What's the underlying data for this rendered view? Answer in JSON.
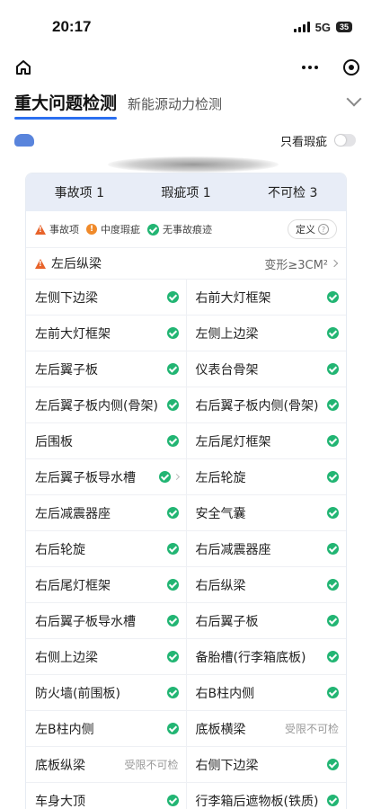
{
  "status": {
    "time": "20:17",
    "network": "5G",
    "battery": "35"
  },
  "tabs": {
    "active": "重大问题检测",
    "next": "新能源动力检测"
  },
  "filter": {
    "label": "只看瑕疵"
  },
  "summary": [
    {
      "label": "事故项 1"
    },
    {
      "label": "瑕疵项 1"
    },
    {
      "label": "不可检 3"
    }
  ],
  "legend": {
    "accident": "事故项",
    "moderate": "中度瑕疵",
    "ok": "无事故痕迹",
    "definition": "定义"
  },
  "major_issue": {
    "label": "左后纵梁",
    "desc": "变形≥3CM²"
  },
  "rows": [
    [
      {
        "label": "左侧下边梁",
        "status": "ok"
      },
      {
        "label": "右前大灯框架",
        "status": "ok"
      }
    ],
    [
      {
        "label": "左前大灯框架",
        "status": "ok"
      },
      {
        "label": "左侧上边梁",
        "status": "ok"
      }
    ],
    [
      {
        "label": "左后翼子板",
        "status": "ok"
      },
      {
        "label": "仪表台骨架",
        "status": "ok"
      }
    ],
    [
      {
        "label": "左后翼子板内侧(骨架)",
        "status": "ok"
      },
      {
        "label": "右后翼子板内侧(骨架)",
        "status": "ok"
      }
    ],
    [
      {
        "label": "后围板",
        "status": "ok"
      },
      {
        "label": "左后尾灯框架",
        "status": "ok"
      }
    ],
    [
      {
        "label": "左后翼子板导水槽",
        "status": "ok",
        "chevron": true
      },
      {
        "label": "左后轮旋",
        "status": "ok"
      }
    ],
    [
      {
        "label": "左后减震器座",
        "status": "ok"
      },
      {
        "label": "安全气囊",
        "status": "ok"
      }
    ],
    [
      {
        "label": "右后轮旋",
        "status": "ok"
      },
      {
        "label": "右后减震器座",
        "status": "ok"
      }
    ],
    [
      {
        "label": "右后尾灯框架",
        "status": "ok"
      },
      {
        "label": "右后纵梁",
        "status": "ok"
      }
    ],
    [
      {
        "label": "右后翼子板导水槽",
        "status": "ok"
      },
      {
        "label": "右后翼子板",
        "status": "ok"
      }
    ],
    [
      {
        "label": "右侧上边梁",
        "status": "ok"
      },
      {
        "label": "备胎槽(行李箱底板)",
        "status": "ok"
      }
    ],
    [
      {
        "label": "防火墙(前围板)",
        "status": "ok"
      },
      {
        "label": "右B柱内侧",
        "status": "ok"
      }
    ],
    [
      {
        "label": "左B柱内侧",
        "status": "ok"
      },
      {
        "label": "底板横梁",
        "status": "na",
        "status_text": "受限不可检"
      }
    ],
    [
      {
        "label": "底板纵梁",
        "status": "na",
        "status_text": "受限不可检"
      },
      {
        "label": "右侧下边梁",
        "status": "ok"
      }
    ],
    [
      {
        "label": "车身大顶",
        "status": "ok"
      },
      {
        "label": "行李箱后遮物板(铁质)",
        "status": "ok"
      }
    ]
  ],
  "colors": {
    "accent": "#2b6ff0",
    "ok": "#22b573",
    "accident": "#e8632a",
    "moderate": "#f08a2a",
    "summary_bg": "#e8edf7"
  }
}
